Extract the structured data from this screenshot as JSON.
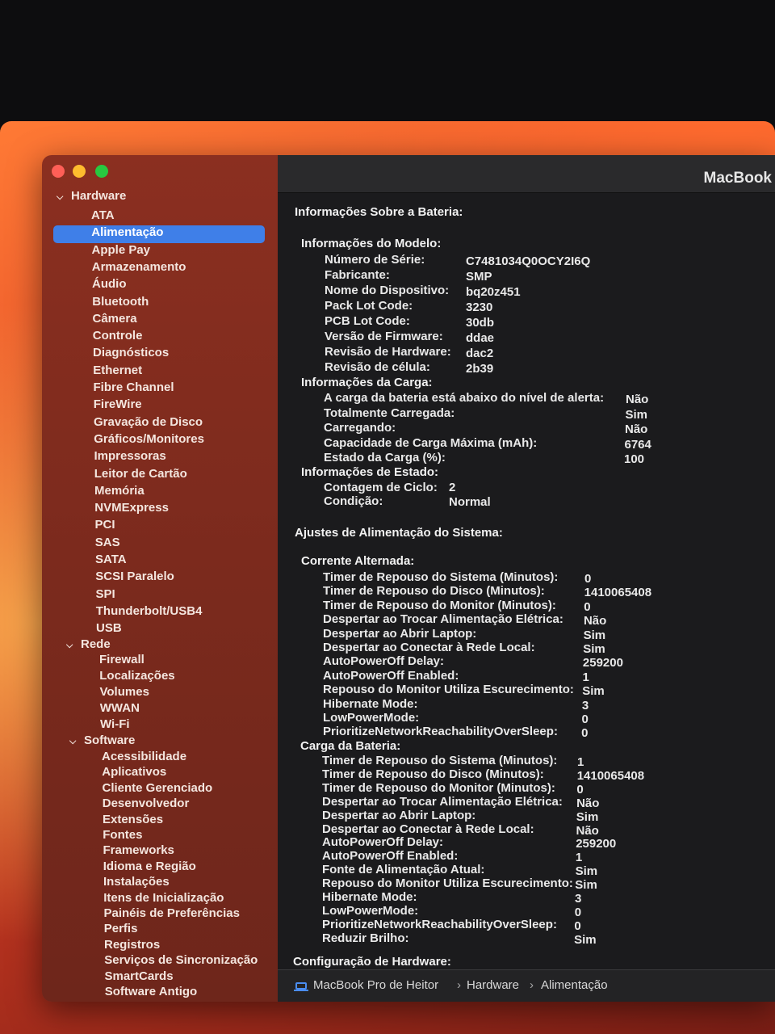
{
  "window": {
    "title": "MacBook"
  },
  "sidebar": {
    "groups": [
      {
        "label": "Hardware",
        "items": [
          "ATA",
          "Alimentação",
          "Apple Pay",
          "Armazenamento",
          "Áudio",
          "Bluetooth",
          "Câmera",
          "Controle",
          "Diagnósticos",
          "Ethernet",
          "Fibre Channel",
          "FireWire",
          "Gravação de Disco",
          "Gráficos/Monitores",
          "Impressoras",
          "Leitor de Cartão",
          "Memória",
          "NVMExpress",
          "PCI",
          "SAS",
          "SATA",
          "SCSI Paralelo",
          "SPI",
          "Thunderbolt/USB4",
          "USB"
        ]
      },
      {
        "label": "Rede",
        "items": [
          "Firewall",
          "Localizações",
          "Volumes",
          "WWAN",
          "Wi-Fi"
        ]
      },
      {
        "label": "Software",
        "items": [
          "Acessibilidade",
          "Aplicativos",
          "Cliente Gerenciado",
          "Desenvolvedor",
          "Extensões",
          "Fontes",
          "Frameworks",
          "Idioma e Região",
          "Instalações",
          "Itens de Inicialização",
          "Painéis de Preferências",
          "Perfis",
          "Registros",
          "Serviços de Sincronização",
          "SmartCards",
          "Software Antigo"
        ]
      }
    ],
    "selected": "Alimentação"
  },
  "content": {
    "battery_title": "Informações Sobre a Bateria:",
    "model_title": "Informações do Modelo:",
    "model": [
      {
        "k": "Número de Série:",
        "v": "C7481034Q0OCY2I6Q"
      },
      {
        "k": "Fabricante:",
        "v": "SMP"
      },
      {
        "k": "Nome do Dispositivo:",
        "v": "bq20z451"
      },
      {
        "k": "Pack Lot Code:",
        "v": "3230"
      },
      {
        "k": "PCB Lot Code:",
        "v": "30db"
      },
      {
        "k": "Versão de Firmware:",
        "v": "ddae"
      },
      {
        "k": "Revisão de Hardware:",
        "v": "dac2"
      },
      {
        "k": "Revisão de célula:",
        "v": "2b39"
      }
    ],
    "charge_title": "Informações da Carga:",
    "charge": [
      {
        "k": "A carga da bateria está abaixo do nível de alerta:",
        "v": "Não"
      },
      {
        "k": "Totalmente Carregada:",
        "v": "Sim"
      },
      {
        "k": "Carregando:",
        "v": "Não"
      },
      {
        "k": "Capacidade de Carga Máxima (mAh):",
        "v": "6764"
      },
      {
        "k": "Estado da Carga (%):",
        "v": "100"
      }
    ],
    "state_title": "Informações de Estado:",
    "state": [
      {
        "k": "Contagem de Ciclo:",
        "v": "2"
      },
      {
        "k": "Condição:",
        "v": "Normal"
      }
    ],
    "power_title": "Ajustes de Alimentação do Sistema:",
    "ac_title": "Corrente Alternada:",
    "ac": [
      {
        "k": "Timer de Repouso do Sistema (Minutos):",
        "v": "0"
      },
      {
        "k": "Timer de Repouso do Disco (Minutos):",
        "v": "1410065408"
      },
      {
        "k": "Timer de Repouso do Monitor (Minutos):",
        "v": "0"
      },
      {
        "k": "Despertar ao Trocar Alimentação Elétrica:",
        "v": "Não"
      },
      {
        "k": "Despertar ao Abrir Laptop:",
        "v": "Sim"
      },
      {
        "k": "Despertar ao Conectar à Rede Local:",
        "v": "Sim"
      },
      {
        "k": "AutoPowerOff Delay:",
        "v": "259200"
      },
      {
        "k": "AutoPowerOff Enabled:",
        "v": "1"
      },
      {
        "k": "Repouso do Monitor Utiliza Escurecimento:",
        "v": "Sim"
      },
      {
        "k": "Hibernate Mode:",
        "v": "3"
      },
      {
        "k": "LowPowerMode:",
        "v": "0"
      },
      {
        "k": "PrioritizeNetworkReachabilityOverSleep:",
        "v": "0"
      }
    ],
    "battery_power_title": "Carga da Bateria:",
    "battery_power": [
      {
        "k": "Timer de Repouso do Sistema (Minutos):",
        "v": "1"
      },
      {
        "k": "Timer de Repouso do Disco (Minutos):",
        "v": "1410065408"
      },
      {
        "k": "Timer de Repouso do Monitor (Minutos):",
        "v": "0"
      },
      {
        "k": "Despertar ao Trocar Alimentação Elétrica:",
        "v": "Não"
      },
      {
        "k": "Despertar ao Abrir Laptop:",
        "v": "Sim"
      },
      {
        "k": "Despertar ao Conectar à Rede Local:",
        "v": "Não"
      },
      {
        "k": "AutoPowerOff Delay:",
        "v": "259200"
      },
      {
        "k": "AutoPowerOff Enabled:",
        "v": "1"
      },
      {
        "k": "Fonte de Alimentação Atual:",
        "v": "Sim"
      },
      {
        "k": "Repouso do Monitor Utiliza Escurecimento:",
        "v": "Sim"
      },
      {
        "k": "Hibernate Mode:",
        "v": "3"
      },
      {
        "k": "LowPowerMode:",
        "v": "0"
      },
      {
        "k": "PrioritizeNetworkReachabilityOverSleep:",
        "v": "0"
      },
      {
        "k": "Reduzir Brilho:",
        "v": "Sim"
      }
    ],
    "hardware_config_title": "Configuração de Hardware:"
  },
  "pathbar": {
    "items": [
      "MacBook Pro de Heitor",
      "Hardware",
      "Alimentação"
    ],
    "separator": "›"
  }
}
